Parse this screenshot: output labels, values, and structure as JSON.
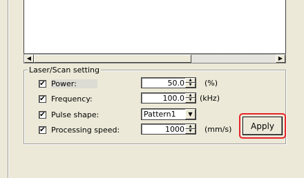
{
  "section_title": "Laser/Scan setting",
  "rows": [
    {
      "label": "Power:",
      "checked": "✔",
      "value": "50.0",
      "unit": "(%)"
    },
    {
      "label": "Frequency:",
      "checked": "✔",
      "value": "100.0",
      "unit": "(kHz)"
    },
    {
      "label": "Pulse shape:",
      "checked": "✔",
      "value": "Pattern1"
    },
    {
      "label": "Processing speed:",
      "checked": "✔",
      "value": "1000",
      "unit": "(mm/s)"
    }
  ],
  "apply_label": "Apply",
  "icons": {
    "scroll_left": "◀",
    "scroll_right": "▶",
    "spin_up": "▲",
    "spin_down": "▼",
    "dropdown": "▼"
  },
  "colors": {
    "highlight_ring": "#e8232a",
    "window_bg": "#ece9d8"
  }
}
